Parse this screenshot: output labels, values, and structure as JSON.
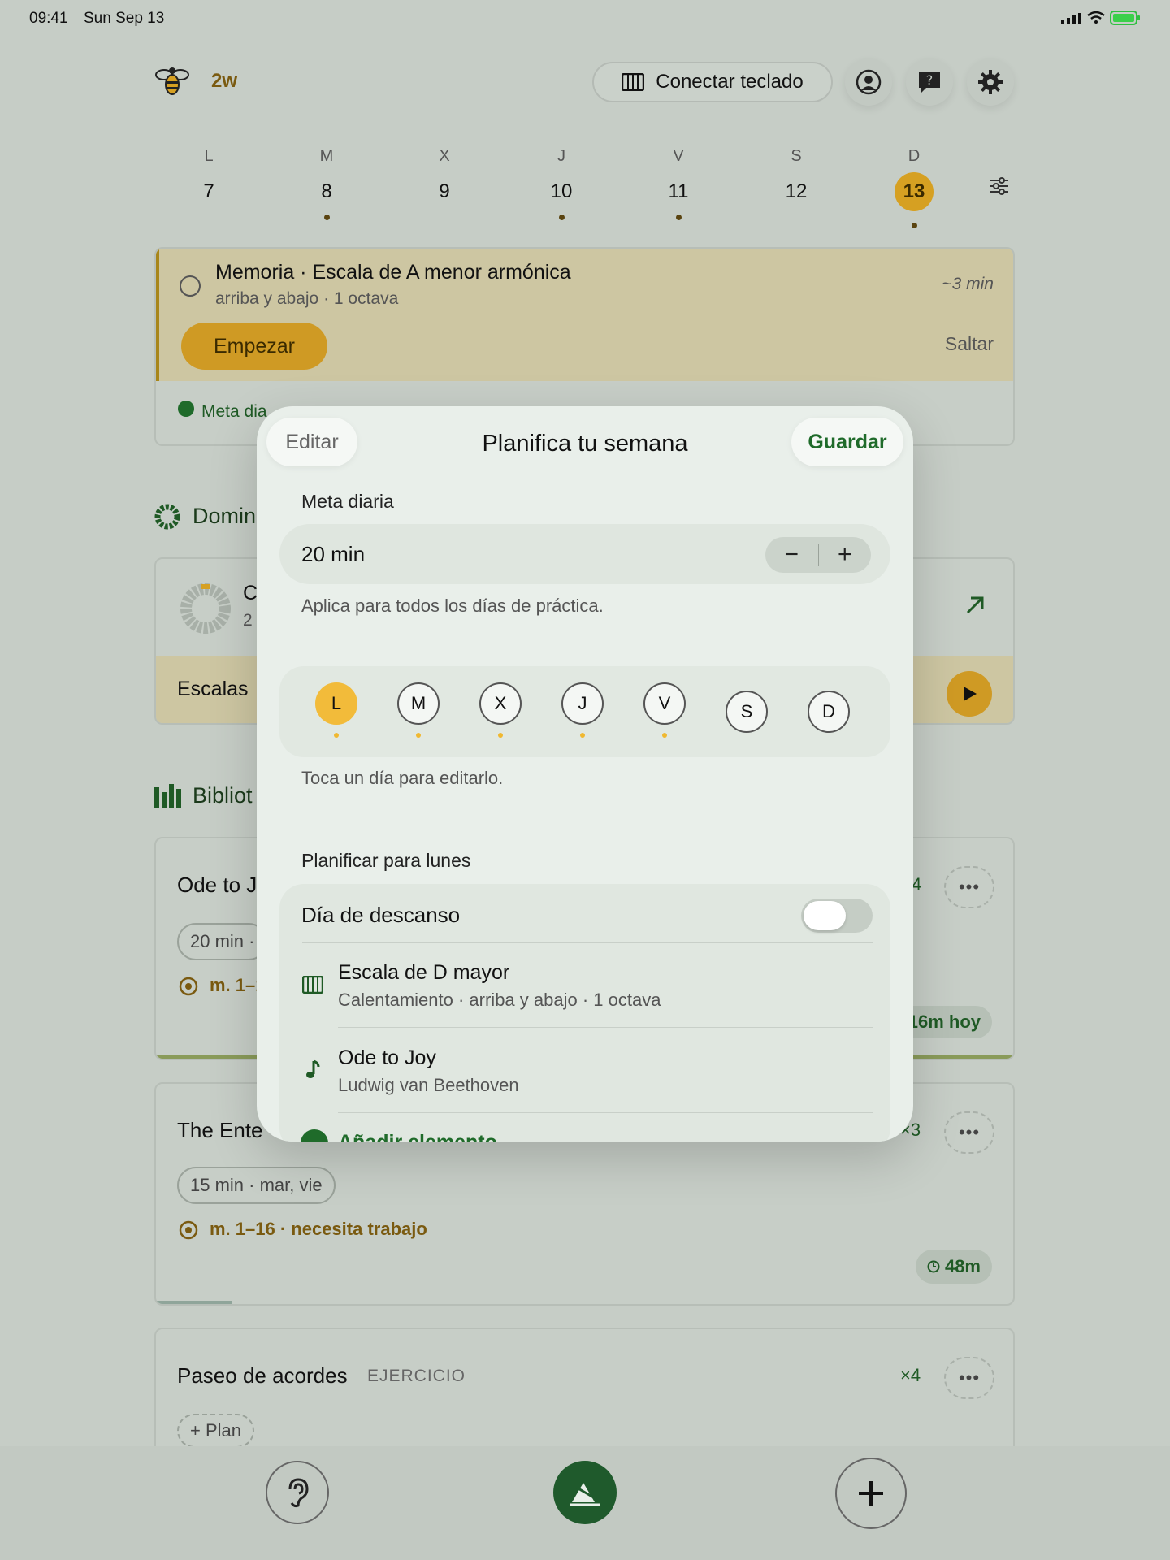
{
  "status": {
    "time": "09:41",
    "date": "Sun Sep 13"
  },
  "header": {
    "brand": "2w",
    "connect_label": "Conectar teclado"
  },
  "week": [
    {
      "letter": "L",
      "num": "7",
      "dot": false
    },
    {
      "letter": "M",
      "num": "8",
      "dot": true
    },
    {
      "letter": "X",
      "num": "9",
      "dot": false
    },
    {
      "letter": "J",
      "num": "10",
      "dot": true
    },
    {
      "letter": "V",
      "num": "11",
      "dot": true
    },
    {
      "letter": "S",
      "num": "12",
      "dot": false
    },
    {
      "letter": "D",
      "num": "13",
      "dot": true,
      "active": true
    }
  ],
  "task": {
    "title": "Memoria · Escala de A menor armónica",
    "subtitle": "arriba y abajo · 1 octava",
    "duration": "~3 min",
    "start_label": "Empezar",
    "skip_label": "Saltar",
    "goal_partial": "Meta dia"
  },
  "sections": {
    "domin": "Domin",
    "bibliot": "Bibliot"
  },
  "domin_card": {
    "a": "C",
    "b": "2",
    "strip": "Escalas"
  },
  "library": [
    {
      "title": "Ode to J",
      "count": "4",
      "tag": "20 min ·",
      "progress_text": "m. 1–1",
      "today": "16m hoy"
    },
    {
      "title": "The Ente",
      "count": "×3",
      "tag": "15 min · mar, vie",
      "progress_text": "m. 1–16 · necesita trabajo",
      "time": "48m"
    },
    {
      "title": "Paseo de acordes",
      "kind": "EJERCICIO",
      "count": "×4",
      "tag": "+ Plan"
    }
  ],
  "modal": {
    "edit": "Editar",
    "title": "Planifica tu semana",
    "save": "Guardar",
    "goal_label": "Meta diaria",
    "goal_value": "20 min",
    "minus": "−",
    "plus": "+",
    "goal_help": "Aplica para todos los días de práctica.",
    "days": [
      {
        "letter": "L",
        "selected": true,
        "dot": true
      },
      {
        "letter": "M",
        "selected": false,
        "dot": true
      },
      {
        "letter": "X",
        "selected": false,
        "dot": true
      },
      {
        "letter": "J",
        "selected": false,
        "dot": true
      },
      {
        "letter": "V",
        "selected": false,
        "dot": true
      },
      {
        "letter": "S",
        "selected": false,
        "dot": false
      },
      {
        "letter": "D",
        "selected": false,
        "dot": false
      }
    ],
    "days_help": "Toca un día para editarlo.",
    "plan_label": "Planificar para lunes",
    "rest_label": "Día de descanso",
    "items": [
      {
        "title": "Escala de D mayor",
        "subtitle": "Calentamiento · arriba y abajo · 1 octava",
        "icon": "keyboard-icon"
      },
      {
        "title": "Ode to Joy",
        "subtitle": "Ludwig van Beethoven",
        "icon": "music-note-icon"
      }
    ],
    "add_label": "Añadir elemento"
  }
}
